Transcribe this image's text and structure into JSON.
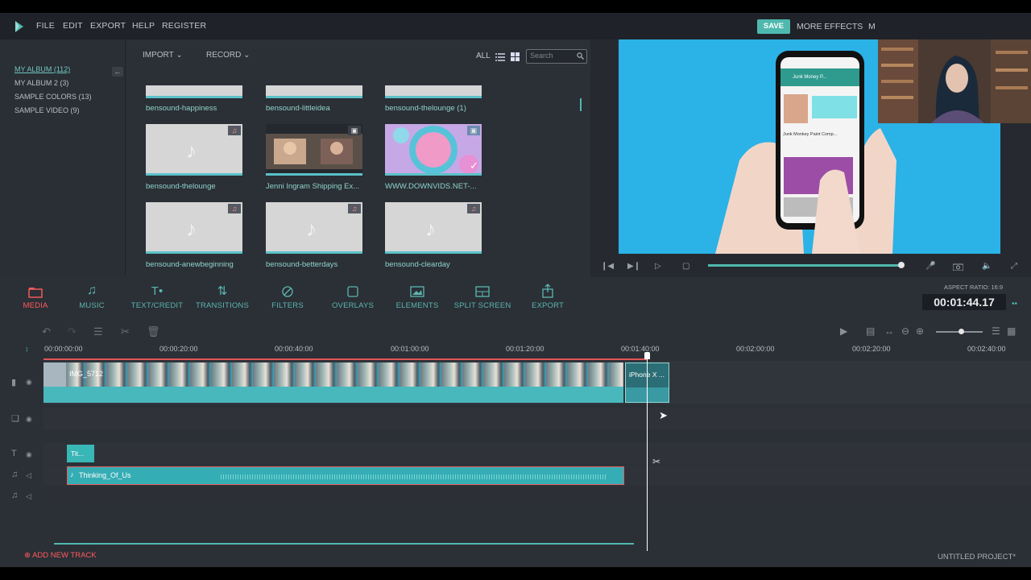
{
  "menu": {
    "file": "FILE",
    "edit": "EDIT",
    "export": "EXPORT",
    "help": "HELP",
    "register": "REGISTER",
    "save": "SAVE",
    "more_effects": "MORE EFFECTS",
    "truncated": "M"
  },
  "albums": [
    "MY ALBUM (112)",
    "MY ALBUM 2 (3)",
    "SAMPLE COLORS (13)",
    "SAMPLE VIDEO (9)"
  ],
  "media_toolbar": {
    "import": "IMPORT",
    "record": "RECORD",
    "all": "ALL",
    "search_placeholder": "Search"
  },
  "media_items": [
    "bensound-happiness",
    "bensound-littleidea",
    "bensound-thelounge (1)",
    "bensound-thelounge",
    "Jenni Ingram Shipping Ex...",
    "WWW.DOWNVIDS.NET-...",
    "bensound-anewbeginning",
    "bensound-betterdays",
    "bensound-clearday"
  ],
  "preview": {
    "phone_header": "Junk Money P...",
    "phone_caption": "Junk Monkey Paint Comp..."
  },
  "tools": [
    "MEDIA",
    "MUSIC",
    "TEXT/CREDIT",
    "TRANSITIONS",
    "FILTERS",
    "OVERLAYS",
    "ELEMENTS",
    "SPLIT SCREEN",
    "EXPORT"
  ],
  "aspect_ratio": "ASPECT RATIO: 16:9",
  "timecode": "00:01:44.17",
  "ruler": [
    "00:00:00:00",
    "00:00:20:00",
    "00:00:40:00",
    "00:01:00:00",
    "00:01:20:00",
    "00:01:40:00",
    "00:02:00:00",
    "00:02:20:00",
    "00:02:40:00"
  ],
  "clips": {
    "video_main": "IMG_5712",
    "video_second": "iPhone X ...",
    "title": "Tit...",
    "audio": "Thinking_Of_Us"
  },
  "footer": {
    "add_track": "ADD NEW TRACK",
    "project": "UNTITLED PROJECT*"
  },
  "colors": {
    "accent": "#4fb8ae",
    "active": "#ff5c5c",
    "preview_bg": "#2bb2e6"
  },
  "progress": {
    "playback_fraction": 0.97
  }
}
